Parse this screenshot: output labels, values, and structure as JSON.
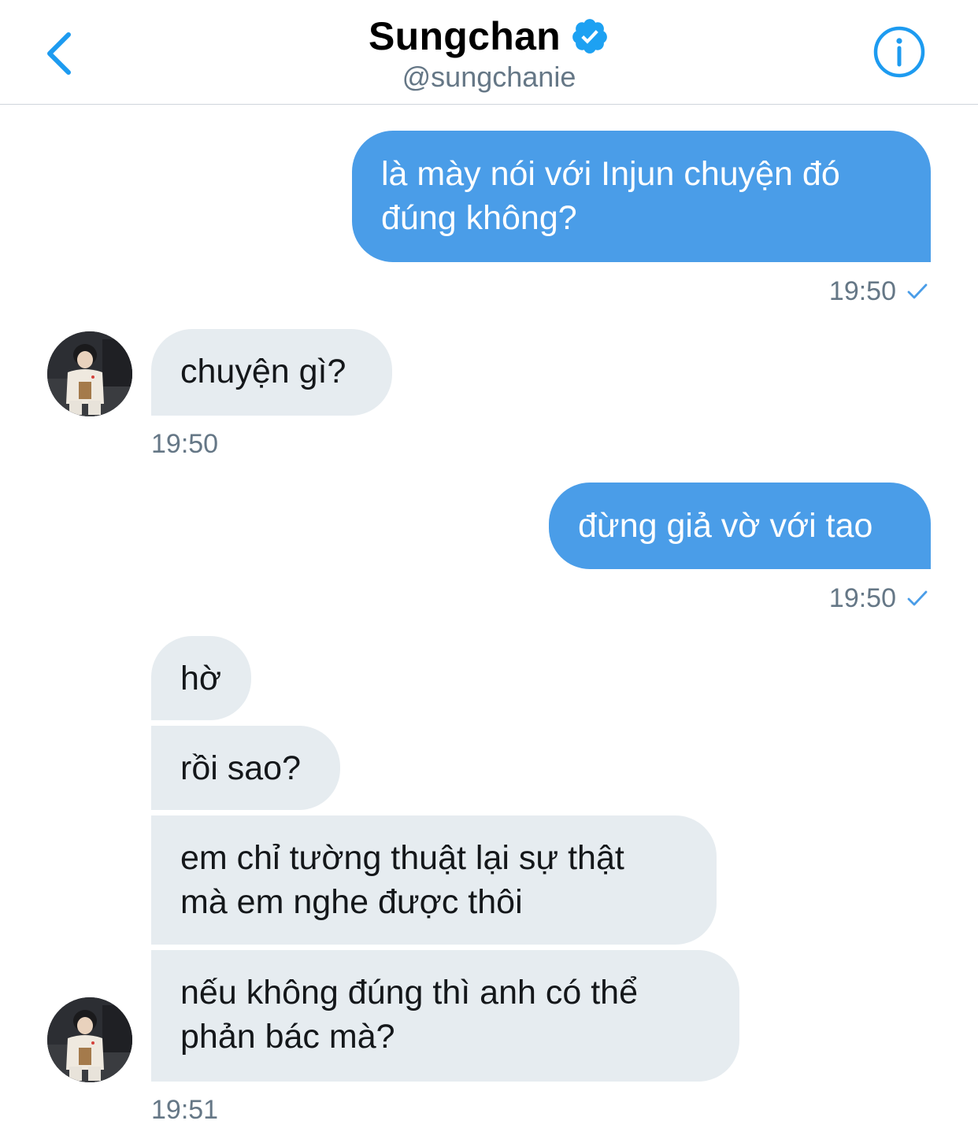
{
  "header": {
    "name": "Sungchan",
    "handle": "@sungchanie",
    "back_icon": "chevron-left-icon",
    "verified_icon": "verified-badge-icon",
    "info_icon": "info-icon"
  },
  "colors": {
    "accent": "#1da1f2",
    "outgoing_bubble": "#4a9de8",
    "incoming_bubble": "#e6ecf0",
    "timestamp": "#657786"
  },
  "messages": [
    {
      "direction": "outgoing",
      "lines": [
        "là mày nói với Injun chuyện đó",
        "đúng không?"
      ],
      "time": "19:50",
      "read_check": true
    },
    {
      "direction": "incoming",
      "lines": [
        "chuyện gì?"
      ],
      "time": "19:50"
    },
    {
      "direction": "outgoing",
      "lines": [
        "đừng giả vờ với tao"
      ],
      "time": "19:50",
      "read_check": true
    },
    {
      "direction": "incoming",
      "lines": [
        "hờ"
      ]
    },
    {
      "direction": "incoming",
      "lines": [
        "rồi sao?"
      ]
    },
    {
      "direction": "incoming",
      "lines": [
        "em chỉ tường thuật lại sự thật",
        "mà em nghe được thôi"
      ]
    },
    {
      "direction": "incoming",
      "lines": [
        "nếu không đúng thì anh có thể",
        "phản bác mà?"
      ],
      "time": "19:51"
    }
  ]
}
